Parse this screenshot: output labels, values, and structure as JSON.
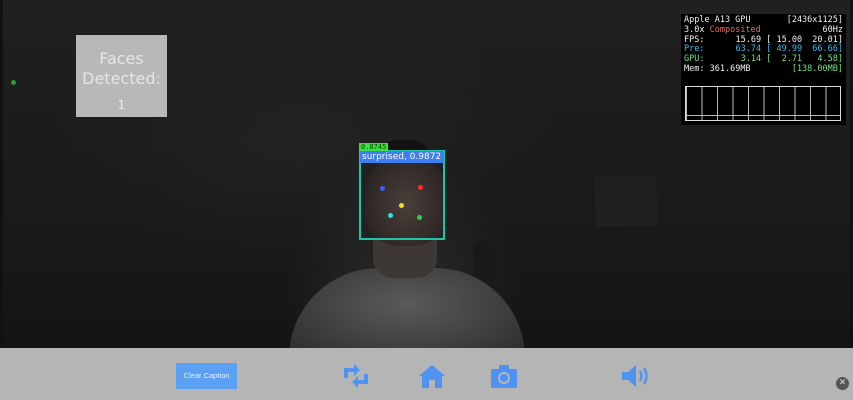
{
  "faces_card": {
    "title": "Faces Detected:",
    "count": "1"
  },
  "detection": {
    "confidence": "0.8745",
    "emotion": "surprised, 0.9872",
    "landmarks": [
      {
        "name": "left-eye",
        "color": "#3b5cff"
      },
      {
        "name": "right-eye",
        "color": "#ff2a2a"
      },
      {
        "name": "nose",
        "color": "#f2e21a"
      },
      {
        "name": "mouth-left",
        "color": "#2ee0e8"
      },
      {
        "name": "mouth-right",
        "color": "#30d14a"
      }
    ]
  },
  "stats": {
    "gpu_name": "Apple A13 GPU",
    "resolution": "[2436x1125]",
    "scale": "3.0x",
    "mode": "Composited",
    "refresh": "60Hz",
    "fps_label": "FPS:",
    "fps_value": "15.69 [ 15.00  20.01]",
    "pre_label": "Pre:",
    "pre_value": "63.74 [ 49.99  66.66]",
    "gpu_label": "GPU:",
    "gpu_value": "3.14 [  2.71   4.58]",
    "mem_label": "Mem:",
    "mem_value": "361.69MB",
    "mem_peak": "[138.00MB]"
  },
  "toolbar": {
    "clear_caption": "Clear Caption",
    "icons": [
      "switch-camera-icon",
      "home-icon",
      "camera-icon",
      "speaker-icon",
      "close-icon"
    ]
  },
  "colors": {
    "box": "#22c3a6",
    "emotion_bg": "#3d7ef0",
    "confidence_bg": "#38e33d",
    "toolbar_icon": "#4f93f2",
    "mode_text": "#e86a5a",
    "pre_text": "#3fb8e8",
    "gpu_text": "#6fe27a"
  }
}
